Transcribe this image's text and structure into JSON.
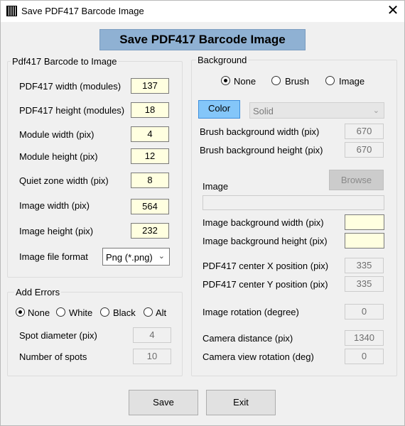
{
  "window": {
    "title": "Save PDF417 Barcode Image",
    "close_icon": "close-icon",
    "app_icon": "barcode-icon"
  },
  "banner": {
    "label": "Save PDF417 Barcode Image"
  },
  "barcode_group": {
    "legend": "Pdf417 Barcode to Image",
    "fields": [
      {
        "label": "PDF417 width (modules)",
        "value": "137"
      },
      {
        "label": "PDF417 height (modules)",
        "value": "18"
      },
      {
        "label": "Module width (pix)",
        "value": "4"
      },
      {
        "label": "Module height (pix)",
        "value": "12"
      },
      {
        "label": "Quiet zone width (pix)",
        "value": "8"
      },
      {
        "label": "Image width (pix)",
        "value": "564"
      },
      {
        "label": "Image height (pix)",
        "value": "232"
      }
    ],
    "format_label": "Image file format",
    "format_value": "Png (*.png)"
  },
  "errors_group": {
    "legend": "Add Errors",
    "options": [
      "None",
      "White",
      "Black",
      "Alt"
    ],
    "selected": "None",
    "spot_label": "Spot diameter (pix)",
    "spot_value": "4",
    "count_label": "Number of spots",
    "count_value": "10"
  },
  "background_group": {
    "legend": "Background",
    "options": [
      "None",
      "Brush",
      "Image"
    ],
    "selected": "None",
    "color_button": "Color",
    "brush_style": "Solid",
    "brush_width_label": "Brush background width (pix)",
    "brush_width_value": "670",
    "brush_height_label": "Brush background height (pix)",
    "brush_height_value": "670",
    "browse_button": "Browse",
    "image_label": "Image",
    "image_path": "",
    "img_width_label": "Image background width (pix)",
    "img_width_value": "",
    "img_height_label": "Image background height (pix)",
    "img_height_value": "",
    "center_x_label": "PDF417 center X position (pix)",
    "center_x_value": "335",
    "center_y_label": "PDF417 center Y position (pix)",
    "center_y_value": "335",
    "rotation_label": "Image rotation (degree)",
    "rotation_value": "0",
    "camera_dist_label": "Camera distance (pix)",
    "camera_dist_value": "1340",
    "camera_rot_label": "Camera view rotation (deg)",
    "camera_rot_value": "0"
  },
  "footer": {
    "save": "Save",
    "exit": "Exit"
  }
}
